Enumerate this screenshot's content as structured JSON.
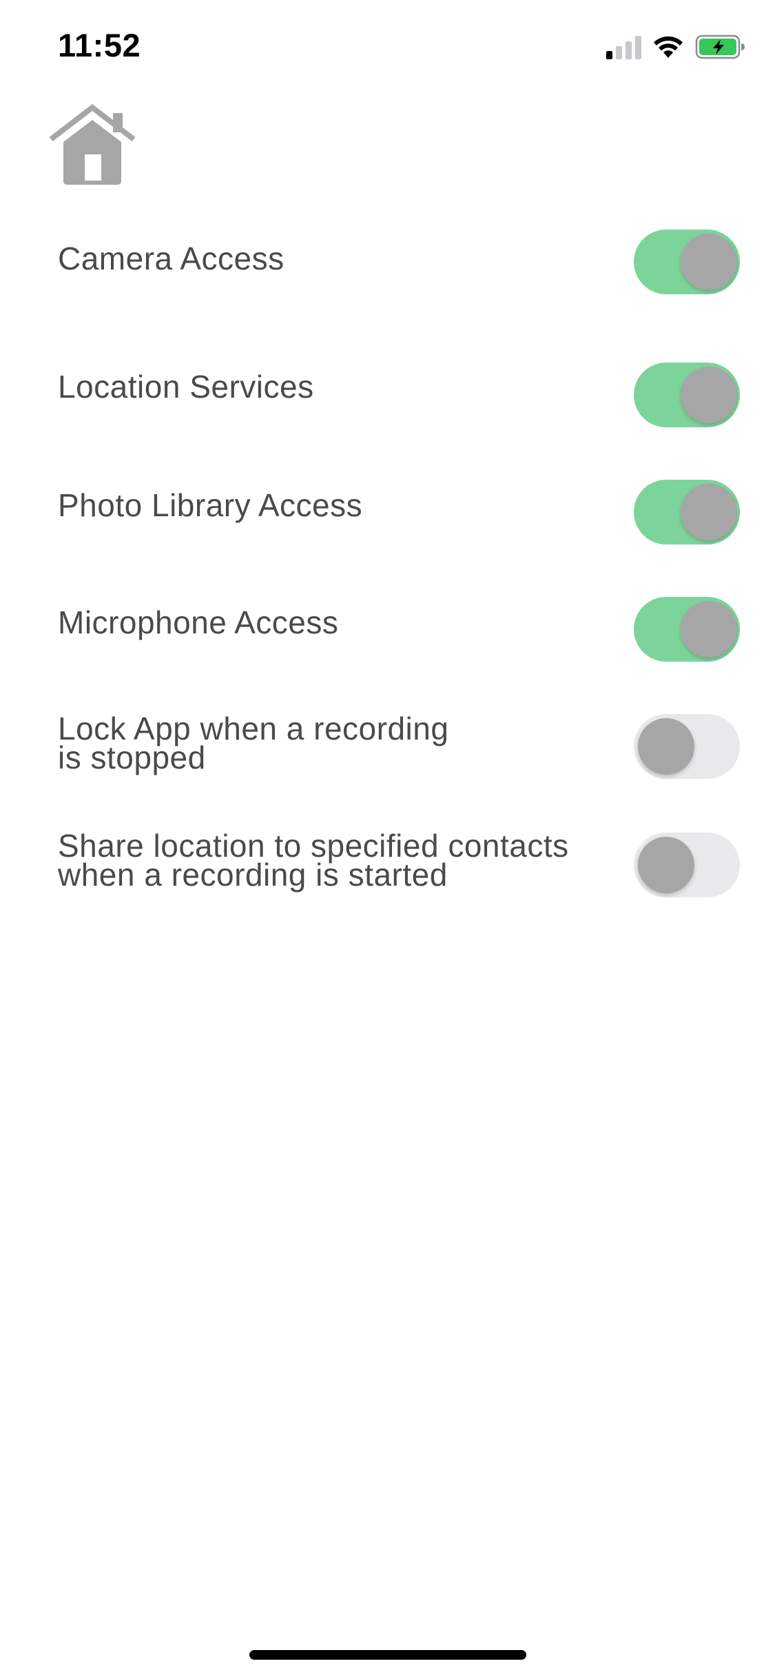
{
  "status_bar": {
    "time": "11:52",
    "signal_bars_active": 1,
    "signal_bars_total": 4,
    "wifi": "wifi-icon",
    "battery": "battery-charging-icon",
    "battery_color": "#34c759"
  },
  "header": {
    "home_icon": "home-icon",
    "home_icon_color": "#a6a6a6"
  },
  "settings": [
    {
      "label": "Camera Access",
      "enabled": true
    },
    {
      "label": "Location Services",
      "enabled": true
    },
    {
      "label": "Photo Library Access",
      "enabled": true
    },
    {
      "label": "Microphone Access",
      "enabled": true
    },
    {
      "label": "Lock App when a recording\nis stopped",
      "enabled": false
    },
    {
      "label": "Share location to specified contacts\nwhen a recording is started",
      "enabled": false
    }
  ],
  "colors": {
    "toggle_on": "#7dd49a",
    "toggle_off": "#e9e9eb",
    "knob": "#a6a6a6",
    "label_text": "#4a4a4a"
  }
}
